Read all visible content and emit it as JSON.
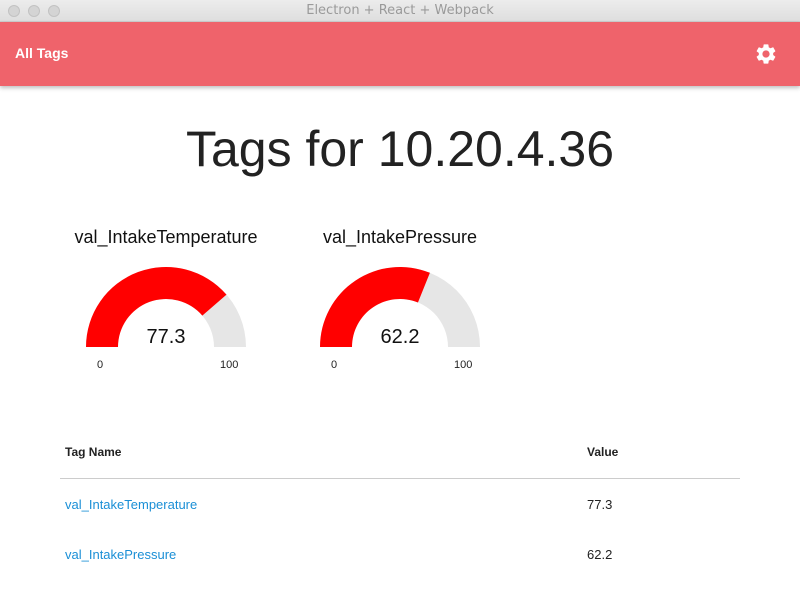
{
  "window": {
    "title": "Electron + React + Webpack"
  },
  "appbar": {
    "title": "All Tags",
    "settings_icon": "gear-icon",
    "background_color": "#ef636b"
  },
  "page": {
    "title": "Tags for 10.20.4.36"
  },
  "gauges": [
    {
      "label": "val_IntakeTemperature",
      "value": 77.3,
      "value_text": "77.3",
      "min": "0",
      "max": "100"
    },
    {
      "label": "val_IntakePressure",
      "value": 62.2,
      "value_text": "62.2",
      "min": "0",
      "max": "100"
    }
  ],
  "gauge_colors": {
    "fill": "#ff0000",
    "track": "#e6e6e6"
  },
  "table": {
    "columns": [
      "Tag Name",
      "Value"
    ],
    "rows": [
      {
        "name": "val_IntakeTemperature",
        "value": "77.3"
      },
      {
        "name": "val_IntakePressure",
        "value": "62.2"
      }
    ],
    "link_color": "#1a8fd6"
  }
}
